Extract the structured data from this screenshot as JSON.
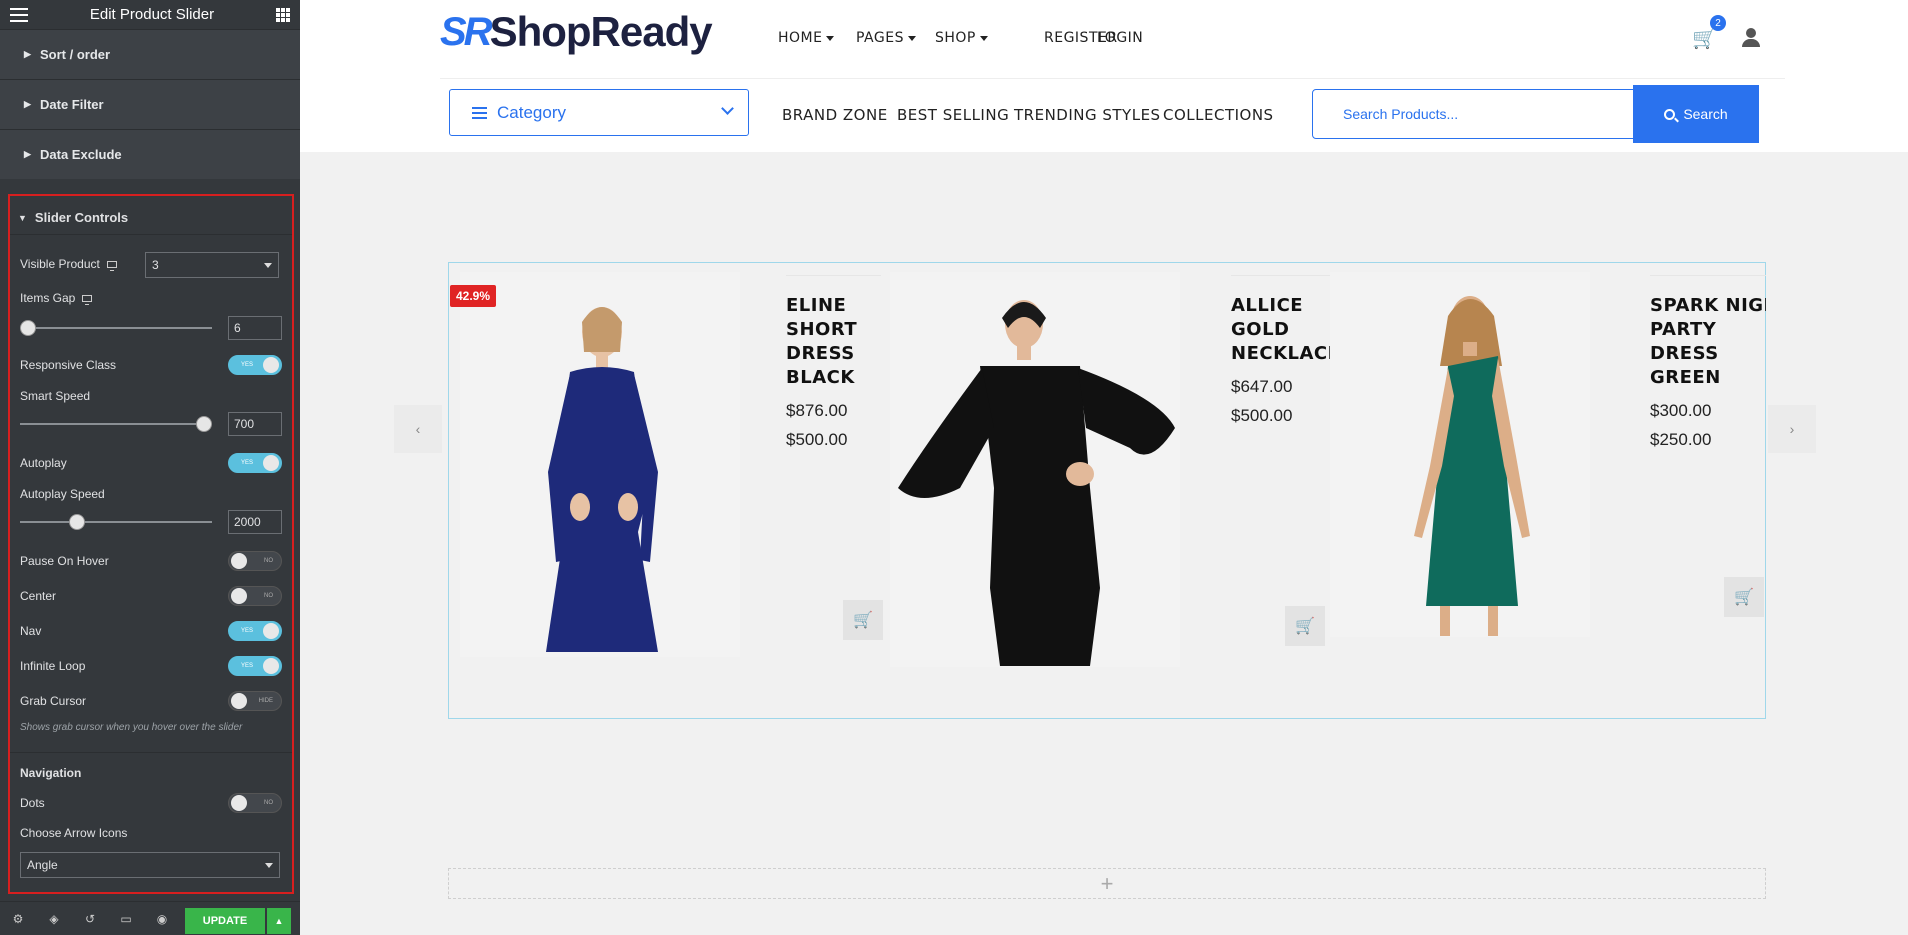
{
  "panel": {
    "title": "Edit Product Slider",
    "sections": [
      "Sort / order",
      "Date Filter",
      "Data Exclude"
    ],
    "open_section": "Slider Controls",
    "controls": {
      "visible_product_label": "Visible Product",
      "visible_product_value": "3",
      "items_gap_label": "Items Gap",
      "items_gap_value": "6",
      "items_gap_level": 0.0,
      "responsive_class_label": "Responsive Class",
      "responsive_class_state": "YES",
      "smart_speed_label": "Smart Speed",
      "smart_speed_value": "700",
      "smart_speed_level": 1.0,
      "autoplay_label": "Autoplay",
      "autoplay_state": "YES",
      "autoplay_speed_label": "Autoplay Speed",
      "autoplay_speed_value": "2000",
      "autoplay_speed_level": 0.28,
      "pause_on_hover_label": "Pause On Hover",
      "pause_on_hover_state": "NO",
      "center_label": "Center",
      "center_state": "NO",
      "nav_label": "Nav",
      "nav_state": "YES",
      "infinite_loop_label": "Infinite Loop",
      "infinite_loop_state": "YES",
      "grab_cursor_label": "Grab Cursor",
      "grab_cursor_state": "HIDE",
      "grab_cursor_help": "Shows grab cursor when you hover over the slider",
      "navigation_heading": "Navigation",
      "dots_label": "Dots",
      "dots_state": "NO",
      "arrow_icons_label": "Choose Arrow Icons",
      "arrow_icons_value": "Angle"
    },
    "footer": {
      "update_label": "UPDATE"
    }
  },
  "site": {
    "logo_mark": "SR",
    "logo_word": "ShopReady",
    "nav": [
      "HOME",
      "PAGES",
      "SHOP",
      "REGISTER",
      "LOGIN"
    ],
    "cart_count": "2",
    "category_label": "Category",
    "subnav": [
      "BRAND ZONE",
      "BEST SELLING",
      "TRENDING STYLES",
      "COLLECTIONS"
    ],
    "search_placeholder": "Search Products...",
    "search_button": "Search"
  },
  "products": [
    {
      "name_lines": [
        "ELINE",
        "SHORT",
        "DRESS",
        "BLACK"
      ],
      "regular_price": "$876.00",
      "sale_price": "$500.00",
      "badge": "42.9%",
      "dress_color": "#1e2a7a"
    },
    {
      "name_lines": [
        "ALLICE",
        "GOLD",
        "NECKLACE"
      ],
      "regular_price": "$647.00",
      "sale_price": "$500.00",
      "dress_color": "#111111"
    },
    {
      "name_lines": [
        "SPARK NIGH",
        "PARTY",
        "DRESS",
        "GREEN"
      ],
      "regular_price": "$300.00",
      "sale_price": "$250.00",
      "dress_color": "#0f6b5c"
    }
  ],
  "icons": {
    "cart": "cart-icon",
    "user": "user-icon",
    "search": "search-icon",
    "plus": "plus-icon"
  },
  "colors": {
    "accent": "#2a72ee",
    "toggle_on": "#5bc0de",
    "update": "#39b54a",
    "highlight": "#d71f1f",
    "sale_badge": "#e02424"
  }
}
